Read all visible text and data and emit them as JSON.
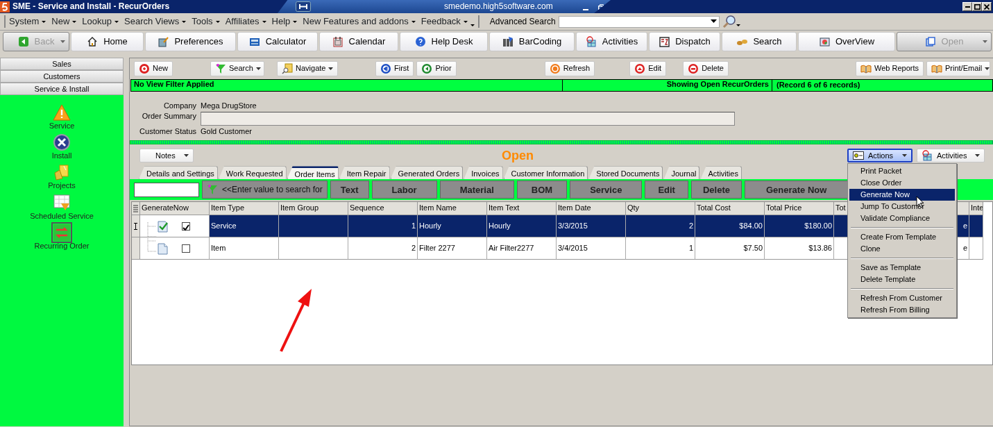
{
  "window": {
    "title": "SME - Service and Install - RecurOrders",
    "host": "smedemo.high5software.com"
  },
  "menu_bar": [
    {
      "label": "System"
    },
    {
      "label": "New"
    },
    {
      "label": "Lookup"
    },
    {
      "label": "Search Views"
    },
    {
      "label": "Tools"
    },
    {
      "label": "Affiliates"
    },
    {
      "label": "Help"
    },
    {
      "label": "New Features and addons"
    },
    {
      "label": "Feedback"
    }
  ],
  "advanced_search": {
    "label": "Advanced Search"
  },
  "main_toolbar": [
    {
      "label": "Back",
      "disabled": true,
      "dropdown": true
    },
    {
      "label": "Home",
      "disabled": false,
      "dropdown": false
    },
    {
      "label": "Preferences",
      "disabled": false,
      "dropdown": false
    },
    {
      "label": "Calculator",
      "disabled": false,
      "dropdown": false
    },
    {
      "label": "Calendar",
      "disabled": false,
      "dropdown": false
    },
    {
      "label": "Help Desk",
      "disabled": false,
      "dropdown": false
    },
    {
      "label": "BarCoding",
      "disabled": false,
      "dropdown": false
    },
    {
      "label": "Activities",
      "disabled": false,
      "dropdown": false
    },
    {
      "label": "Dispatch",
      "disabled": false,
      "dropdown": false
    },
    {
      "label": "Search",
      "disabled": false,
      "dropdown": false
    },
    {
      "label": "OverView",
      "disabled": false,
      "dropdown": false
    },
    {
      "label": "Open",
      "disabled": true,
      "dropdown": true
    }
  ],
  "sidebar": {
    "sections": [
      "Sales",
      "Customers",
      "Service & Install"
    ],
    "items": [
      {
        "label": "Service",
        "selected": false
      },
      {
        "label": "Install",
        "selected": false
      },
      {
        "label": "Projects",
        "selected": false
      },
      {
        "label": "Scheduled Service",
        "selected": false
      },
      {
        "label": "Recurring Order",
        "selected": true
      }
    ]
  },
  "record_toolbar": [
    {
      "label": "New",
      "dropdown": false
    },
    {
      "label": "Search",
      "dropdown": true
    },
    {
      "label": "Navigate",
      "dropdown": true
    },
    {
      "label": "First",
      "dropdown": false
    },
    {
      "label": "Prior",
      "dropdown": false
    },
    {
      "label": "Refresh",
      "dropdown": false
    },
    {
      "label": "Edit",
      "dropdown": false
    },
    {
      "label": "Delete",
      "dropdown": false
    },
    {
      "label": "Web Reports",
      "dropdown": false
    },
    {
      "label": "Print/Email",
      "dropdown": true
    }
  ],
  "status_bar": {
    "filter": "No View Filter Applied",
    "view": "Showing Open RecurOrders",
    "record": "(Record 6 of 6 records)"
  },
  "form": {
    "fields": [
      {
        "kind": "text",
        "label": "Company",
        "value": "Mega DrugStore"
      },
      {
        "kind": "input",
        "label": "Order Summary"
      },
      {
        "kind": "text",
        "label": "Customer Status",
        "value": "Gold Customer"
      }
    ]
  },
  "notes_button": {
    "label": "Notes"
  },
  "order_status": "Open",
  "actions_button": {
    "label": "Actions",
    "expanded": true
  },
  "activities_button": {
    "label": "Activities"
  },
  "tabs": [
    {
      "label": "Details and Settings",
      "selected": false
    },
    {
      "label": "Work Requested",
      "selected": false
    },
    {
      "label": "Order Items",
      "selected": true
    },
    {
      "label": "Item Repair",
      "selected": false
    },
    {
      "label": "Generated Orders",
      "selected": false
    },
    {
      "label": "Invoices",
      "selected": false
    },
    {
      "label": "Customer Information",
      "selected": false
    },
    {
      "label": "Stored Documents",
      "selected": false
    },
    {
      "label": "Journal",
      "selected": false
    },
    {
      "label": "Activities",
      "selected": false
    }
  ],
  "item_toolbar": {
    "search_button": "<<Enter value to search for",
    "buttons": [
      "Text",
      "Labor",
      "Material",
      "BOM",
      "Service",
      "Edit",
      "Delete",
      "Generate Now"
    ]
  },
  "table": {
    "columns": [
      {
        "label": "GenerateNow"
      },
      {
        "label": "Item Type"
      },
      {
        "label": "Item Group"
      },
      {
        "label": "Sequence"
      },
      {
        "label": "Item Name"
      },
      {
        "label": "Item Text"
      },
      {
        "label": "Item Date"
      },
      {
        "label": "Qty"
      },
      {
        "label": "Total Cost"
      },
      {
        "label": "Total Price"
      },
      {
        "label": "Tot"
      },
      {},
      {
        "label": "Inte"
      }
    ],
    "rows": [
      {
        "selected": true,
        "kind": "checked",
        "generate_now": true,
        "cells": [
          "",
          "Service",
          "",
          "1",
          "Hourly",
          "Hourly",
          "3/3/2015",
          "2",
          "$84.00",
          "$180.00",
          "",
          "e",
          ""
        ]
      },
      {
        "selected": false,
        "kind": "plain",
        "generate_now": false,
        "cells": [
          "",
          "Item",
          "",
          "2",
          "Filter 2277",
          "Air Filter2277",
          "3/4/2015",
          "1",
          "$7.50",
          "$13.86",
          "",
          "e",
          ""
        ]
      }
    ]
  },
  "actions_menu": {
    "groups": [
      [
        {
          "label": "Print Packet",
          "selected": false
        },
        {
          "label": "Close Order",
          "selected": false
        },
        {
          "label": "Generate Now",
          "selected": true
        },
        {
          "label": "Jump To Customer",
          "selected": false
        },
        {
          "label": "Validate Compliance",
          "selected": false
        }
      ],
      [
        {
          "label": "Create From Template",
          "selected": false
        },
        {
          "label": "Clone",
          "selected": false
        }
      ],
      [
        {
          "label": "Save as Template",
          "selected": false
        },
        {
          "label": "Delete Template",
          "selected": false
        }
      ],
      [
        {
          "label": "Refresh From Customer",
          "selected": false
        },
        {
          "label": "Refresh From Billing",
          "selected": false
        }
      ]
    ]
  }
}
